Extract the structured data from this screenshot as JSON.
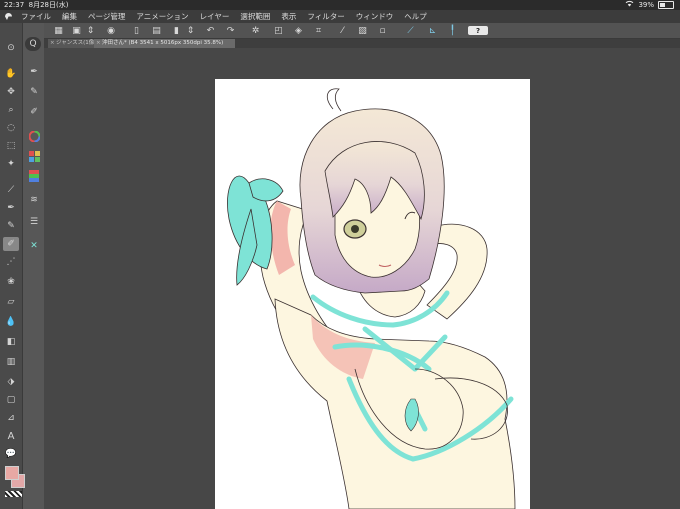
{
  "status_bar": {
    "time": "22:37",
    "date": "8月28日(水)",
    "battery": "39%",
    "battery_level": 0.39,
    "wifi_icon": "wifi-icon"
  },
  "menu": {
    "items": [
      "ファイル",
      "編集",
      "ページ管理",
      "アニメーション",
      "レイヤー",
      "選択範囲",
      "表示",
      "フィルター",
      "ウィンドウ",
      "ヘルプ"
    ]
  },
  "toolbar": {
    "icons": [
      "grid-icon",
      "canvas-icon",
      "spinner-icon",
      "eye-icon",
      "new-icon",
      "open-icon",
      "save-icon",
      "phone-icon",
      "undo-icon",
      "redo-icon",
      "transform-icon",
      "clear-icon",
      "fill-icon",
      "crop-icon",
      "slash-icon",
      "select-icon",
      "trash-icon",
      "ruler-icon",
      "ruler2-icon",
      "pen-icon"
    ],
    "help_label": "?"
  },
  "tabs": [
    {
      "label": "ジャンスス(1像)"
    },
    {
      "label": "沖田さん* (B4 3541 x 5016px 350dpi 35.8%)"
    }
  ],
  "tools": {
    "left": [
      "zoom-icon",
      "hand-icon",
      "move-icon",
      "zoom-tool-icon",
      "select-lasso-icon",
      "select-rect-icon",
      "wand-icon",
      "eyedropper-icon",
      "pen-tool-icon",
      "pencil-icon",
      "brush-icon",
      "airbrush-icon",
      "decoration-icon",
      "eraser-icon",
      "blend-icon",
      "fill-tool-icon",
      "gradient-icon",
      "figure-icon",
      "frame-icon",
      "ruler-tool-icon",
      "text-icon",
      "balloon-icon",
      "correct-line-icon"
    ],
    "sub": [
      "magnify-icon",
      "pen-sub-icon",
      "marker-icon",
      "brush-sub-icon",
      "color-wheel-icon",
      "color-set-icon",
      "color-slider-icon",
      "brush-size-icon",
      "layers-icon",
      "navigator-icon"
    ]
  },
  "colors": {
    "foreground": "#e8a8a4",
    "background": "#e3a8a8",
    "accent_cyan": "#7ee3d6",
    "skin": "#fdf6e0",
    "hair_top": "#f4e8d6",
    "hair_bottom": "#c5a9c7"
  }
}
